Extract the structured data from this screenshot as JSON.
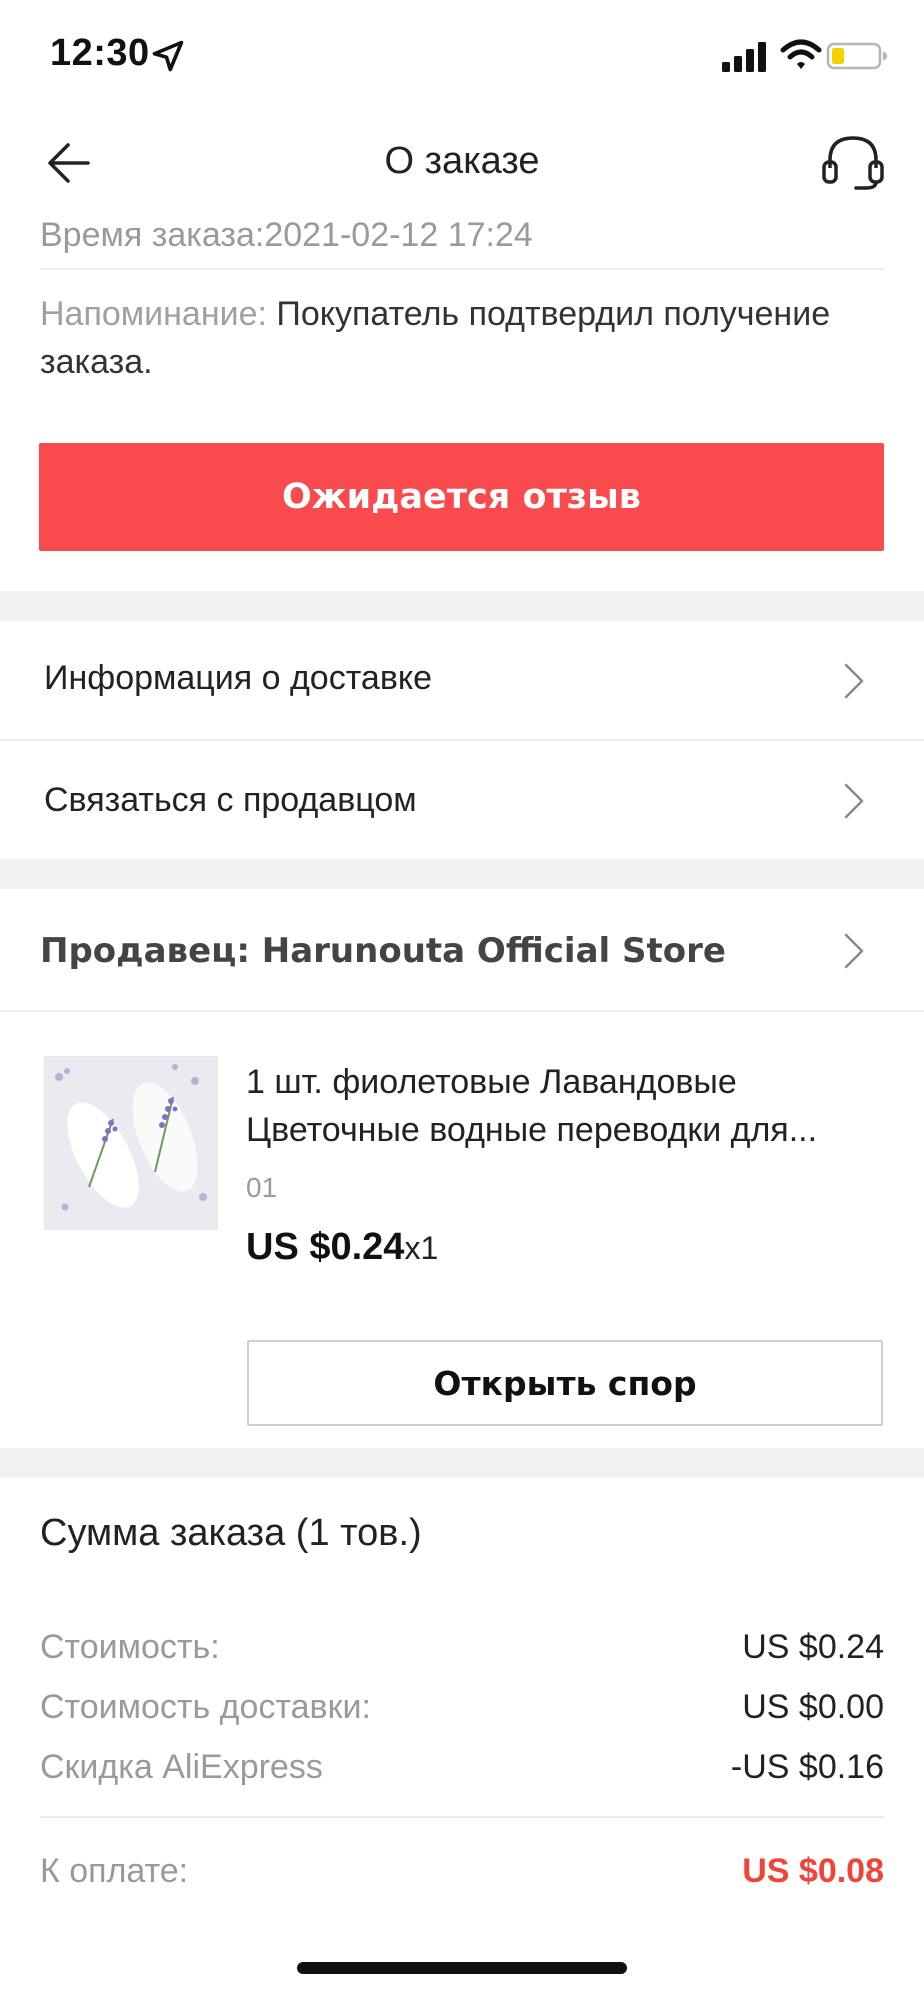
{
  "status_bar": {
    "time": "12:30",
    "icons": [
      "location-arrow-icon",
      "cellular-signal-icon",
      "wifi-icon",
      "battery-icon"
    ]
  },
  "nav": {
    "title": "О заказе",
    "back_icon": "arrow-left-icon",
    "support_icon": "headset-icon"
  },
  "order": {
    "time_label": "Время заказа:",
    "time_value": "2021-02-12 17:24",
    "reminder_label": "Напоминание:",
    "reminder_text": "Покупатель подтвердил получение заказа.",
    "status_button": "Ожидается отзыв"
  },
  "menu": {
    "delivery_info": "Информация о доставке",
    "contact_seller": "Связаться с продавцом"
  },
  "seller": {
    "label": "Продавец: Harunouta Official Store"
  },
  "product": {
    "title_line1": "1 шт. фиолетовые Лавандовые",
    "title_line2": "Цветочные водные переводки для...",
    "sku": "01",
    "price": "US $0.24",
    "quantity": "x1",
    "dispute_button": "Открыть спор"
  },
  "summary": {
    "title": "Сумма заказа (1 тов.)",
    "rows": [
      {
        "label": "Стоимость:",
        "value": "US $0.24"
      },
      {
        "label": "Стоимость доставки:",
        "value": "US $0.00"
      },
      {
        "label": "Скидка AliExpress",
        "value": "-US $0.16"
      }
    ],
    "total_label": "К оплате:",
    "total_value": "US $0.08"
  },
  "colors": {
    "accent": "#f94a4d",
    "total": "#f0443a",
    "muted": "#9a9a9a",
    "section_gap": "#f2f2f2"
  }
}
